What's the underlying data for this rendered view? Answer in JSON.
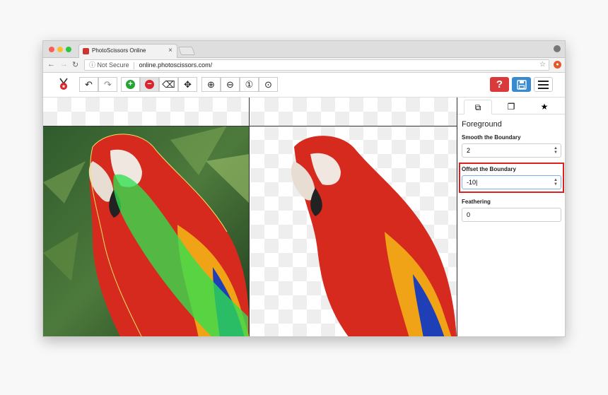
{
  "browser": {
    "tab_title": "PhotoScissors Online",
    "tab_close": "×",
    "address_security": "Not Secure",
    "address_url": "online.photoscissors.com/",
    "back_glyph": "←",
    "forward_glyph": "→",
    "reload_glyph": "↻",
    "bookmark_glyph": "☆"
  },
  "toolbar": {
    "undo": "↶",
    "redo": "↷",
    "add_foreground": "+",
    "add_background": "−",
    "eraser": "⌫",
    "move": "✥",
    "zoom_in": "⊕",
    "zoom_out": "⊖",
    "zoom_actual": "①",
    "zoom_fit": "⊙",
    "help": "?"
  },
  "sidebar": {
    "title": "Foreground",
    "smooth_label": "Smooth the Boundary",
    "smooth_value": "2",
    "offset_label": "Offset the Boundary",
    "offset_value": "-10",
    "feathering_label": "Feathering",
    "feathering_value": "0"
  },
  "colors": {
    "accent_red": "#e02020",
    "save_blue": "#3a8ad0",
    "help_red": "#d93b3b",
    "add_green": "#22a433",
    "remove_red": "#d9232e"
  },
  "icons": {
    "tab1": "foreground-icon",
    "tab2": "background-icon",
    "tab3": "star-icon"
  }
}
